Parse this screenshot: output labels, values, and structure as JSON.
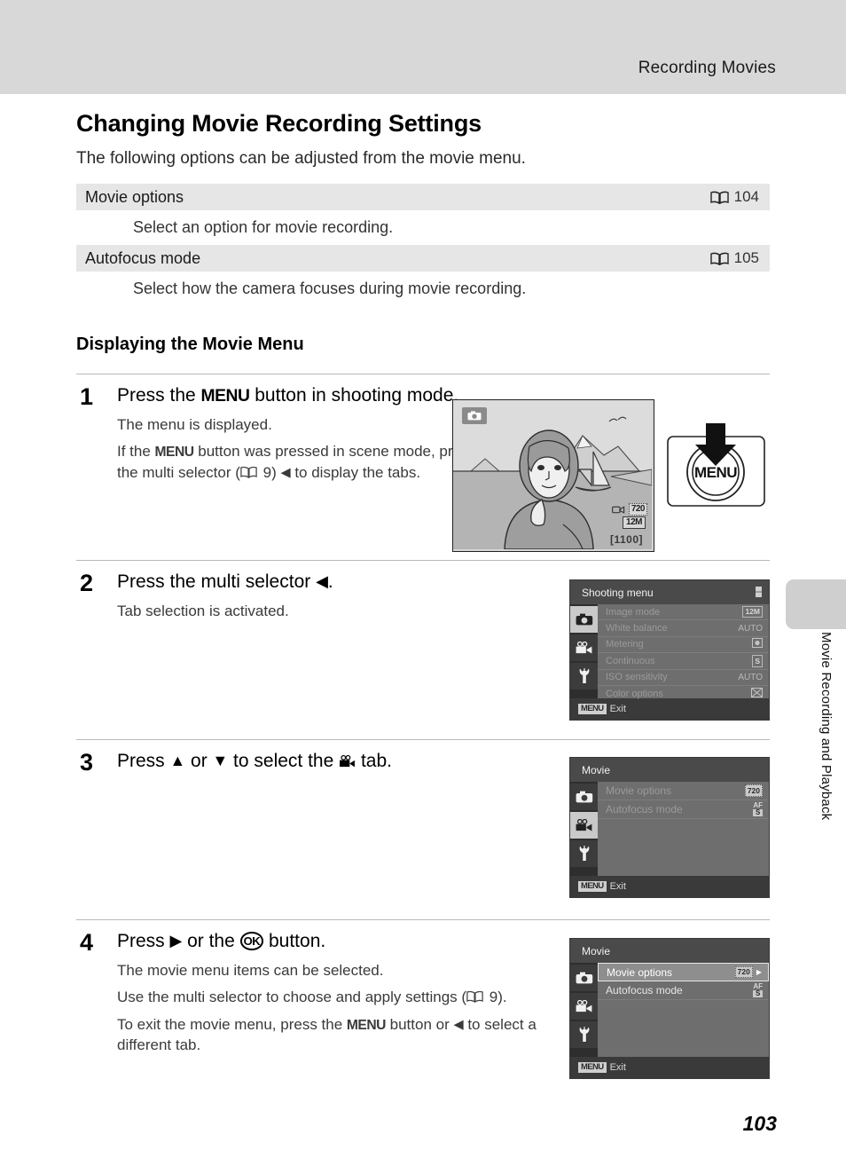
{
  "header": {
    "running_title": "Recording Movies"
  },
  "side_tab": {
    "label": "Movie Recording and Playback"
  },
  "page_number": "103",
  "section": {
    "title": "Changing Movie Recording Settings",
    "intro": "The following options can be adjusted from the movie menu.",
    "options": [
      {
        "name": "Movie options",
        "ref_icon": "book-icon",
        "ref_page": "104",
        "description": "Select an option for movie recording."
      },
      {
        "name": "Autofocus mode",
        "ref_icon": "book-icon",
        "ref_page": "105",
        "description": "Select how the camera focuses during movie recording."
      }
    ]
  },
  "subsection": {
    "title": "Displaying the Movie Menu"
  },
  "steps": [
    {
      "number": "1",
      "head_pre": "Press the ",
      "head_menu": "MENU",
      "head_post": " button in shooting mode.",
      "paragraphs": [
        "The menu is displayed."
      ],
      "note_a": "If the ",
      "note_menu": "MENU",
      "note_b": " button was pressed in scene mode, press the multi selector (",
      "note_ref": "9",
      "note_c": ") ",
      "note_arrow": "◀",
      "note_d": " to display the tabs."
    },
    {
      "number": "2",
      "head_pre": "Press the multi selector ",
      "head_arrow": "◀",
      "head_post": ".",
      "paragraphs": [
        "Tab selection is activated."
      ]
    },
    {
      "number": "3",
      "head_pre": "Press ",
      "head_up": "▲",
      "head_mid": " or ",
      "head_down": "▼",
      "head_post": " to select the ",
      "head_tab_icon": "movie-camera-icon",
      "head_end": " tab.",
      "paragraphs": []
    },
    {
      "number": "4",
      "head_pre": "Press ",
      "head_arrow": "▶",
      "head_mid": " or the ",
      "head_ok": "OK",
      "head_post": " button.",
      "paragraphs": [
        "The movie menu items can be selected."
      ],
      "para_multi_a": "Use the multi selector to choose and apply settings (",
      "para_multi_ref": "9",
      "para_multi_b": ").",
      "para_exit_a": "To exit the movie menu, press the ",
      "para_exit_menu": "MENU",
      "para_exit_b": " button or ",
      "para_exit_arrow": "◀",
      "para_exit_c": " to select a different tab."
    }
  ],
  "illustrations": {
    "step1": {
      "lcd": {
        "mode_icon": "camera-mode-icon",
        "movie_size_badge": "720",
        "image_mode_badge": "12M",
        "shots_remaining": "[1100]",
        "scene_description": "woman portrait with mountains, sea and sailboat"
      },
      "button": {
        "label": "MENU",
        "arrow_icon": "down-arrow-icon"
      }
    },
    "step2_screen": {
      "title": "Shooting menu",
      "tabs": [
        {
          "icon": "camera-icon",
          "selected": true
        },
        {
          "icon": "movie-camera-icon",
          "selected": false
        },
        {
          "icon": "wrench-icon",
          "selected": false
        }
      ],
      "items": [
        {
          "label": "Image mode",
          "value": "12M",
          "value_type": "badge"
        },
        {
          "label": "White balance",
          "value": "AUTO",
          "value_type": "text"
        },
        {
          "label": "Metering",
          "value": "metering-icon",
          "value_type": "icon"
        },
        {
          "label": "Continuous",
          "value": "S",
          "value_type": "badge"
        },
        {
          "label": "ISO sensitivity",
          "value": "AUTO",
          "value_type": "text"
        },
        {
          "label": "Color options",
          "value": "color-options-icon",
          "value_type": "icon"
        }
      ],
      "footer_chip": "MENU",
      "footer_label": "Exit"
    },
    "step3_screen": {
      "title": "Movie",
      "tabs": [
        {
          "icon": "camera-icon",
          "selected": false
        },
        {
          "icon": "movie-camera-icon",
          "selected": true
        },
        {
          "icon": "wrench-icon",
          "selected": false
        }
      ],
      "items": [
        {
          "label": "Movie options",
          "value": "720",
          "value_type": "badge720",
          "highlighted": false
        },
        {
          "label": "Autofocus mode",
          "value": "AF S",
          "value_type": "badgeaf",
          "highlighted": false
        }
      ],
      "footer_chip": "MENU",
      "footer_label": "Exit"
    },
    "step4_screen": {
      "title": "Movie",
      "tabs": [
        {
          "icon": "camera-icon",
          "selected": false
        },
        {
          "icon": "movie-camera-icon",
          "selected": false
        },
        {
          "icon": "wrench-icon",
          "selected": false
        }
      ],
      "items": [
        {
          "label": "Movie options",
          "value": "720",
          "value_type": "badge720",
          "highlighted": true
        },
        {
          "label": "Autofocus mode",
          "value": "AF S",
          "value_type": "badgeaf",
          "highlighted": false
        }
      ],
      "footer_chip": "MENU",
      "footer_label": "Exit"
    }
  },
  "colors": {
    "header_band": "#d8d8d8",
    "table_row": "#e6e6e6",
    "side_tab": "#cfcfcf",
    "screen_body": "#6e6e6e",
    "screen_title": "#4a4a4a"
  }
}
